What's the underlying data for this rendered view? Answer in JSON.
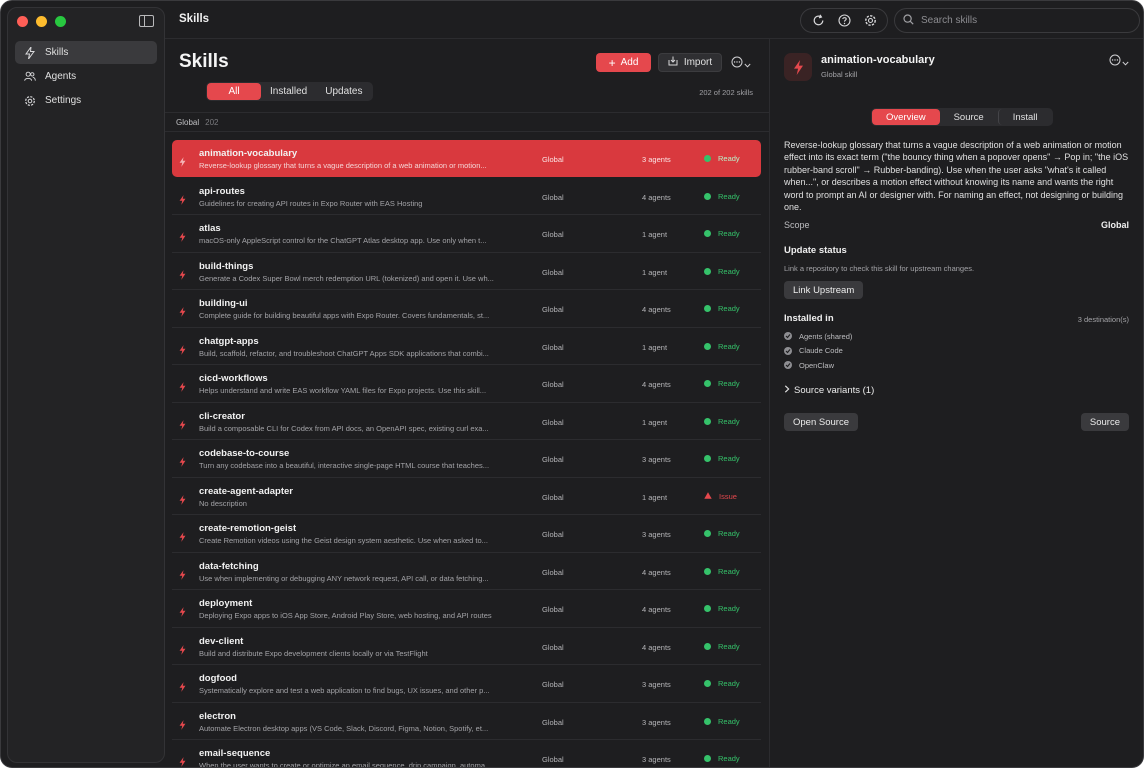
{
  "window": {
    "title": "Skills"
  },
  "sidebar": {
    "items": [
      {
        "label": "Skills",
        "icon": "bolt-icon",
        "active": true
      },
      {
        "label": "Agents",
        "icon": "users-icon",
        "active": false
      },
      {
        "label": "Settings",
        "icon": "gear-icon",
        "active": false
      }
    ]
  },
  "search": {
    "placeholder": "Search skills"
  },
  "main": {
    "title": "Skills",
    "add_label": "Add",
    "import_label": "Import",
    "filters": [
      "All",
      "Installed",
      "Updates"
    ],
    "count_text": "202 of 202 skills",
    "group": {
      "label": "Global",
      "count": "202"
    }
  },
  "skills": [
    {
      "name": "animation-vocabulary",
      "desc": "Reverse-lookup glossary that turns a vague description of a web animation or motion...",
      "scope": "Global",
      "agents": "3 agents",
      "status": "Ready",
      "selected": true
    },
    {
      "name": "api-routes",
      "desc": "Guidelines for creating API routes in Expo Router with EAS Hosting",
      "scope": "Global",
      "agents": "4 agents",
      "status": "Ready"
    },
    {
      "name": "atlas",
      "desc": "macOS-only AppleScript control for the ChatGPT Atlas desktop app. Use only when t...",
      "scope": "Global",
      "agents": "1 agent",
      "status": "Ready"
    },
    {
      "name": "build-things",
      "desc": "Generate a Codex Super Bowl merch redemption URL (tokenized) and open it. Use wh...",
      "scope": "Global",
      "agents": "1 agent",
      "status": "Ready"
    },
    {
      "name": "building-ui",
      "desc": "Complete guide for building beautiful apps with Expo Router. Covers fundamentals, st...",
      "scope": "Global",
      "agents": "4 agents",
      "status": "Ready"
    },
    {
      "name": "chatgpt-apps",
      "desc": "Build, scaffold, refactor, and troubleshoot ChatGPT Apps SDK applications that combi...",
      "scope": "Global",
      "agents": "1 agent",
      "status": "Ready"
    },
    {
      "name": "cicd-workflows",
      "desc": "Helps understand and write EAS workflow YAML files for Expo projects. Use this skill...",
      "scope": "Global",
      "agents": "4 agents",
      "status": "Ready"
    },
    {
      "name": "cli-creator",
      "desc": "Build a composable CLI for Codex from API docs, an OpenAPI spec, existing curl exa...",
      "scope": "Global",
      "agents": "1 agent",
      "status": "Ready"
    },
    {
      "name": "codebase-to-course",
      "desc": "Turn any codebase into a beautiful, interactive single-page HTML course that teaches...",
      "scope": "Global",
      "agents": "3 agents",
      "status": "Ready"
    },
    {
      "name": "create-agent-adapter",
      "desc": "No description",
      "scope": "Global",
      "agents": "1 agent",
      "status": "Issue"
    },
    {
      "name": "create-remotion-geist",
      "desc": "Create Remotion videos using the Geist design system aesthetic. Use when asked to...",
      "scope": "Global",
      "agents": "3 agents",
      "status": "Ready"
    },
    {
      "name": "data-fetching",
      "desc": "Use when implementing or debugging ANY network request, API call, or data fetching...",
      "scope": "Global",
      "agents": "4 agents",
      "status": "Ready"
    },
    {
      "name": "deployment",
      "desc": "Deploying Expo apps to iOS App Store, Android Play Store, web hosting, and API routes",
      "scope": "Global",
      "agents": "4 agents",
      "status": "Ready"
    },
    {
      "name": "dev-client",
      "desc": "Build and distribute Expo development clients locally or via TestFlight",
      "scope": "Global",
      "agents": "4 agents",
      "status": "Ready"
    },
    {
      "name": "dogfood",
      "desc": "Systematically explore and test a web application to find bugs, UX issues, and other p...",
      "scope": "Global",
      "agents": "3 agents",
      "status": "Ready"
    },
    {
      "name": "electron",
      "desc": "Automate Electron desktop apps (VS Code, Slack, Discord, Figma, Notion, Spotify, et...",
      "scope": "Global",
      "agents": "3 agents",
      "status": "Ready"
    },
    {
      "name": "email-sequence",
      "desc": "When the user wants to create or optimize an email sequence, drip campaign, automa...",
      "scope": "Global",
      "agents": "3 agents",
      "status": "Ready"
    }
  ],
  "detail": {
    "title": "animation-vocabulary",
    "subtitle": "Global skill",
    "tabs": [
      "Overview",
      "Source",
      "Install"
    ],
    "description": "Reverse-lookup glossary that turns a vague description of a web animation or motion effect into its exact term (\"the bouncy thing when a popover opens\" → Pop in; \"the iOS rubber-band scroll\" → Rubber-banding). Use when the user asks \"what's it called when...\", or describes a motion effect without knowing its name and wants the right word to prompt an AI or designer with. For naming an effect, not designing or building one.",
    "scope_label": "Scope",
    "scope_value": "Global",
    "update_heading": "Update status",
    "update_note": "Link a repository to check this skill for upstream changes.",
    "link_upstream": "Link Upstream",
    "installed_heading": "Installed in",
    "destinations": "3 destination(s)",
    "installed": [
      "Agents (shared)",
      "Claude Code",
      "OpenClaw"
    ],
    "variants_label": "Source variants (1)",
    "open_source": "Open Source",
    "source": "Source"
  },
  "colors": {
    "accent": "#e5484d",
    "ready": "#35c26a",
    "background": "#1e1e20"
  }
}
